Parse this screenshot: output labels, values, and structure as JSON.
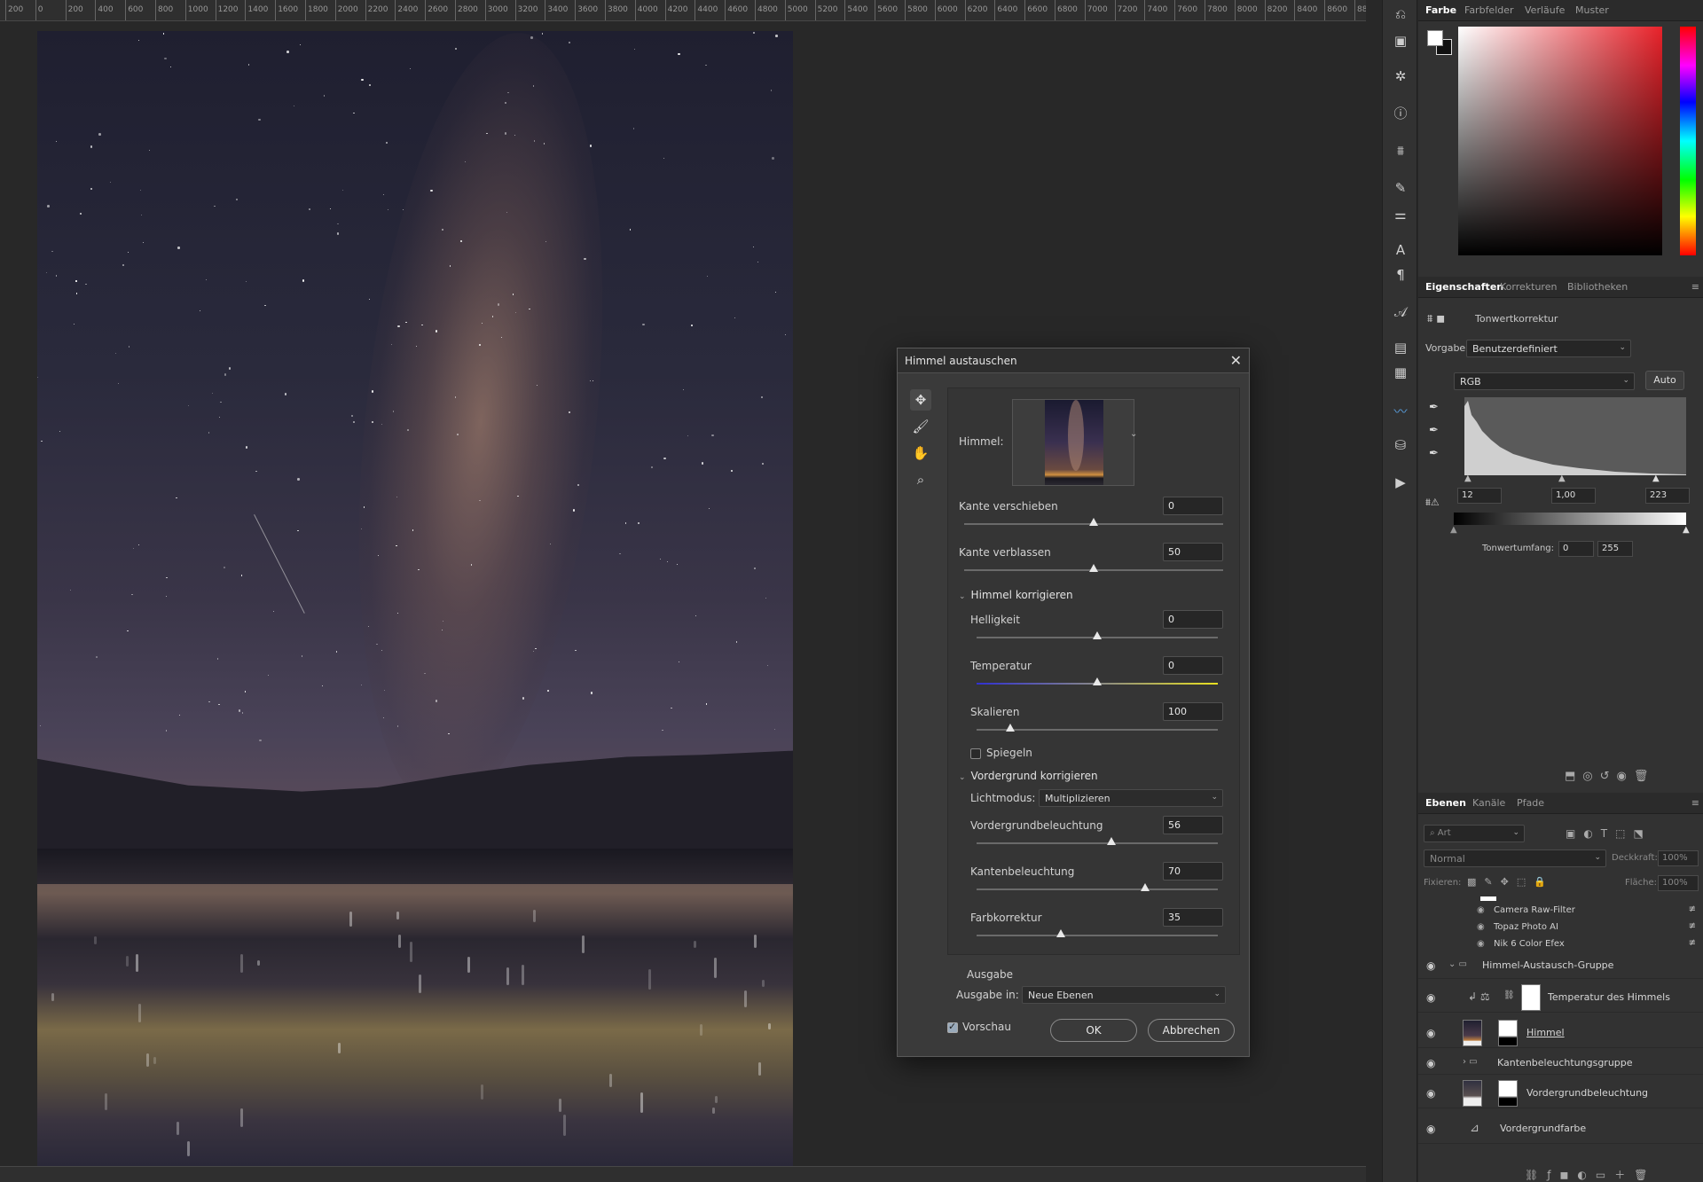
{
  "ruler": {
    "ticks": [
      "200",
      "0",
      "200",
      "400",
      "600",
      "800",
      "1000",
      "1200",
      "1400",
      "1600",
      "1800",
      "2000",
      "2200",
      "2400",
      "2600",
      "2800",
      "3000",
      "3200",
      "3400",
      "3600",
      "3800",
      "4000",
      "4200",
      "4400",
      "4600",
      "4800",
      "5000",
      "5200",
      "5400",
      "5600",
      "5800",
      "6000",
      "6200",
      "6400",
      "6600",
      "6800",
      "7000",
      "7200",
      "7400",
      "7600",
      "7800",
      "8000",
      "8200",
      "8400",
      "8600",
      "88"
    ]
  },
  "color_panel": {
    "tabs": [
      "Farbe",
      "Farbfelder",
      "Verläufe",
      "Muster"
    ]
  },
  "properties": {
    "tabs": [
      "Eigenschaften",
      "Korrekturen",
      "Bibliotheken"
    ],
    "type": "Tonwertkorrektur",
    "preset_label": "Vorgabe:",
    "preset_value": "Benutzerdefiniert",
    "channel": "RGB",
    "auto_label": "Auto",
    "input_black": "12",
    "input_mid": "1,00",
    "input_white": "223",
    "output_label": "Tonwertumfang:",
    "output_black": "0",
    "output_white": "255"
  },
  "layers": {
    "tabs": [
      "Ebenen",
      "Kanäle",
      "Pfade"
    ],
    "search_placeholder": "Art",
    "blend_mode": "Normal",
    "opacity_label": "Deckkraft:",
    "opacity_value": "100%",
    "lock_label": "Fixieren:",
    "fill_label": "Fläche:",
    "fill_value": "100%",
    "filters": [
      "Camera Raw-Filter",
      "Topaz Photo AI",
      "Nik 6 Color Efex"
    ],
    "rows": [
      {
        "name": "Himmel-Austausch-Gruppe"
      },
      {
        "name": "Temperatur des Himmels"
      },
      {
        "name": "Himmel"
      },
      {
        "name": "Kantenbeleuchtungsgruppe"
      },
      {
        "name": "Vordergrundbeleuchtung"
      },
      {
        "name": "Vordergrundfarbe"
      }
    ]
  },
  "dialog": {
    "title": "Himmel austauschen",
    "sky_label": "Himmel:",
    "fields": {
      "kante_verschieben": {
        "label": "Kante verschieben",
        "value": "0",
        "fraction": 0.5
      },
      "kante_verblassen": {
        "label": "Kante verblassen",
        "value": "50",
        "fraction": 0.5
      },
      "helligkeit": {
        "label": "Helligkeit",
        "value": "0",
        "fraction": 0.5
      },
      "temperatur": {
        "label": "Temperatur",
        "value": "0",
        "fraction": 0.5
      },
      "skalieren": {
        "label": "Skalieren",
        "value": "100",
        "fraction": 0.14
      },
      "vordergrundbeleuchtung": {
        "label": "Vordergrundbeleuchtung",
        "value": "56",
        "fraction": 0.56
      },
      "kantenbeleuchtung": {
        "label": "Kantenbeleuchtung",
        "value": "70",
        "fraction": 0.7
      },
      "farbkorrektur": {
        "label": "Farbkorrektur",
        "value": "35",
        "fraction": 0.35
      }
    },
    "section_sky": "Himmel korrigieren",
    "mirror_label": "Spiegeln",
    "section_fg": "Vordergrund korrigieren",
    "light_mode_label": "Lichtmodus:",
    "light_mode_value": "Multiplizieren",
    "output_section": "Ausgabe",
    "output_label": "Ausgabe in:",
    "output_value": "Neue Ebenen",
    "preview_label": "Vorschau",
    "ok_label": "OK",
    "cancel_label": "Abbrechen"
  }
}
